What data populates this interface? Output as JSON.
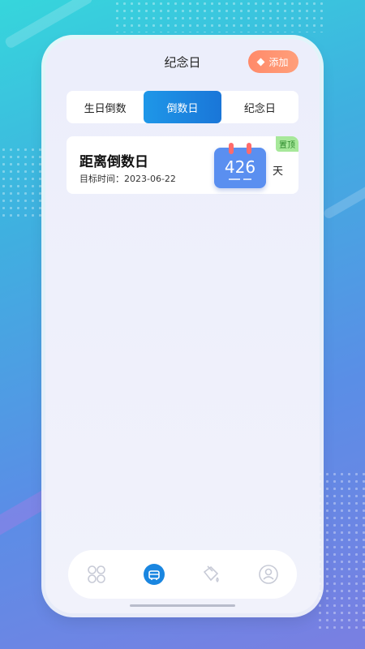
{
  "header": {
    "title": "纪念日",
    "add_label": "添加"
  },
  "tabs": [
    {
      "label": "生日倒数",
      "active": false
    },
    {
      "label": "倒数日",
      "active": true
    },
    {
      "label": "纪念日",
      "active": false
    }
  ],
  "card": {
    "title": "距离倒数日",
    "target_label": "目标时间：",
    "target_date": "2023-06-22",
    "days": "426",
    "unit": "天",
    "pin_label": "置顶"
  },
  "bottom_nav": [
    {
      "icon": "grid-icon",
      "active": false
    },
    {
      "icon": "calendar-icon",
      "active": true
    },
    {
      "icon": "paint-bucket-icon",
      "active": false
    },
    {
      "icon": "profile-icon",
      "active": false
    }
  ],
  "colors": {
    "accent": "#1a86e0",
    "add_button": "#ff8f70",
    "pin": "#a7e89a"
  }
}
